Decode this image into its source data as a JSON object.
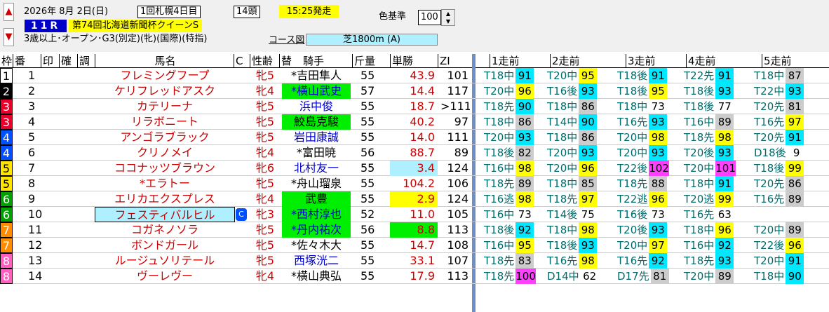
{
  "header": {
    "date": "2026年 8月 2日(日)",
    "meeting": "1回札幌4日目",
    "runners": "14頭",
    "start": "15:25発走",
    "race_no": "11R",
    "race_name": "第74回北海道新聞杯クイーンS",
    "conditions": "3歳以上･オープン･G3(別定)(牝)(国際)(特指)",
    "color_label": "色基準",
    "color_value": "100",
    "course_label": "コース図",
    "course": "芝1800m (A)"
  },
  "columns": {
    "waku": "枠",
    "uma": "番",
    "mark": "印",
    "kaku": "確",
    "cho": "調",
    "name": "馬名",
    "c": "C",
    "sei": "性齢",
    "kae": "替",
    "jockey": "騎手",
    "kin": "斤量",
    "odds": "単勝",
    "zi": "ZI",
    "p1": "1走前",
    "p2": "2走前",
    "p3": "3走前",
    "p4": "4走前",
    "p5": "5走前"
  },
  "colors": {
    "blue_no": "#0000c8",
    "yellow": "#ffff00",
    "green": "#00ee00",
    "cyan": "#aef0ff",
    "red": "#c00000"
  },
  "rows": [
    {
      "waku": "1",
      "uma": "1",
      "name": "フレミングフープ",
      "sei": "牝5",
      "jockey": "*吉田隼人",
      "kg": "55",
      "odds": "43.9",
      "zi": "101",
      "p": [
        [
          "T18中",
          "91"
        ],
        [
          "T20中",
          "95"
        ],
        [
          "T18後",
          "91"
        ],
        [
          "T22先",
          "91"
        ],
        [
          "T18中",
          "87"
        ]
      ]
    },
    {
      "waku": "2",
      "uma": "2",
      "name": "ケリフレッドアスク",
      "sei": "牝4",
      "jockey": "*横山武史",
      "kg": "57",
      "odds": "14.4",
      "zi": "117",
      "p": [
        [
          "T20中",
          "96"
        ],
        [
          "T16後",
          "93"
        ],
        [
          "T18後",
          "95"
        ],
        [
          "T18後",
          "93"
        ],
        [
          "T22中",
          "93"
        ]
      ]
    },
    {
      "waku": "3",
      "uma": "3",
      "name": "カテリーナ",
      "sei": "牝5",
      "jockey": "浜中俊",
      "kg": "55",
      "odds": "18.7",
      "zi": ">111",
      "p": [
        [
          "T18先",
          "90"
        ],
        [
          "T18中",
          "86"
        ],
        [
          "T18中",
          "73"
        ],
        [
          "T18後",
          "77"
        ],
        [
          "T20先",
          "81"
        ]
      ]
    },
    {
      "waku": "3",
      "uma": "4",
      "name": "リラボニート",
      "sei": "牝5",
      "jockey": "鮫島克駿",
      "kg": "55",
      "odds": "40.2",
      "zi": "97",
      "p": [
        [
          "T18中",
          "86"
        ],
        [
          "T14中",
          "90"
        ],
        [
          "T16先",
          "93"
        ],
        [
          "T16中",
          "89"
        ],
        [
          "T16先",
          "97"
        ]
      ]
    },
    {
      "waku": "4",
      "uma": "5",
      "name": "アンゴラブラック",
      "sei": "牝5",
      "jockey": "岩田康誠",
      "kg": "55",
      "odds": "14.0",
      "zi": "111",
      "p": [
        [
          "T20中",
          "93"
        ],
        [
          "T18中",
          "86"
        ],
        [
          "T20中",
          "98"
        ],
        [
          "T18先",
          "98"
        ],
        [
          "T20先",
          "91"
        ]
      ]
    },
    {
      "waku": "4",
      "uma": "6",
      "name": "クリノメイ",
      "sei": "牝4",
      "jockey": "*富田暁",
      "kg": "56",
      "odds": "88.7",
      "zi": "89",
      "p": [
        [
          "T18後",
          "82"
        ],
        [
          "T20中",
          "93"
        ],
        [
          "T20中",
          "93"
        ],
        [
          "T20後",
          "93"
        ],
        [
          "D18後",
          "9"
        ]
      ]
    },
    {
      "waku": "5",
      "uma": "7",
      "name": "ココナッツブラウン",
      "sei": "牝6",
      "jockey": "北村友一",
      "kg": "55",
      "odds": "3.4",
      "zi": "124",
      "p": [
        [
          "T16中",
          "98"
        ],
        [
          "T20中",
          "96"
        ],
        [
          "T22後",
          "102"
        ],
        [
          "T20中",
          "101"
        ],
        [
          "T18後",
          "99"
        ]
      ]
    },
    {
      "waku": "5",
      "uma": "8",
      "name": "*エラトー",
      "sei": "牝5",
      "jockey": "*舟山瑠泉",
      "kg": "55",
      "odds": "104.2",
      "zi": "106",
      "p": [
        [
          "T18先",
          "89"
        ],
        [
          "T18中",
          "85"
        ],
        [
          "T18先",
          "88"
        ],
        [
          "T18中",
          "91"
        ],
        [
          "T20先",
          "86"
        ]
      ]
    },
    {
      "waku": "6",
      "uma": "9",
      "name": "エリカエクスプレス",
      "sei": "牝4",
      "jockey": "武豊",
      "kg": "55",
      "odds": "2.9",
      "zi": "124",
      "p": [
        [
          "T16逃",
          "98"
        ],
        [
          "T18先",
          "97"
        ],
        [
          "T22逃",
          "96"
        ],
        [
          "T20逃",
          "99"
        ],
        [
          "T16先",
          "89"
        ]
      ]
    },
    {
      "waku": "6",
      "uma": "10",
      "name": "フェスティバルヒル",
      "sei": "牝3",
      "jockey": "*西村淳也",
      "kg": "52",
      "odds": "11.0",
      "zi": "105",
      "p": [
        [
          "T16中",
          "73"
        ],
        [
          "T14後",
          "75"
        ],
        [
          "T16後",
          "73"
        ],
        [
          "T16先",
          "63"
        ],
        [
          "",
          ""
        ]
      ]
    },
    {
      "waku": "7",
      "uma": "11",
      "name": "コガネノソラ",
      "sei": "牝5",
      "jockey": "*丹内祐次",
      "kg": "56",
      "odds": "8.8",
      "zi": "113",
      "p": [
        [
          "T18後",
          "92"
        ],
        [
          "T18中",
          "98"
        ],
        [
          "T20後",
          "93"
        ],
        [
          "T18中",
          "96"
        ],
        [
          "T20中",
          "89"
        ]
      ]
    },
    {
      "waku": "7",
      "uma": "12",
      "name": "ボンドガール",
      "sei": "牝5",
      "jockey": "*佐々木大",
      "kg": "55",
      "odds": "14.7",
      "zi": "108",
      "p": [
        [
          "T16中",
          "95"
        ],
        [
          "T18後",
          "93"
        ],
        [
          "T20中",
          "97"
        ],
        [
          "T16中",
          "92"
        ],
        [
          "T22後",
          "96"
        ]
      ]
    },
    {
      "waku": "8",
      "uma": "13",
      "name": "ルージュソリテール",
      "sei": "牝5",
      "jockey": "西塚洸二",
      "kg": "55",
      "odds": "33.1",
      "zi": "107",
      "p": [
        [
          "T18先",
          "83"
        ],
        [
          "T16先",
          "98"
        ],
        [
          "T16先",
          "92"
        ],
        [
          "T18先",
          "93"
        ],
        [
          "T20中",
          "91"
        ]
      ]
    },
    {
      "waku": "8",
      "uma": "14",
      "name": "ヴーレヴー",
      "sei": "牝4",
      "jockey": "*横山典弘",
      "kg": "55",
      "odds": "17.9",
      "zi": "113",
      "p": [
        [
          "T18先",
          "100"
        ],
        [
          "D14中",
          "62"
        ],
        [
          "D17先",
          "81"
        ],
        [
          "T20中",
          "89"
        ],
        [
          "T18中",
          "90"
        ]
      ]
    }
  ]
}
